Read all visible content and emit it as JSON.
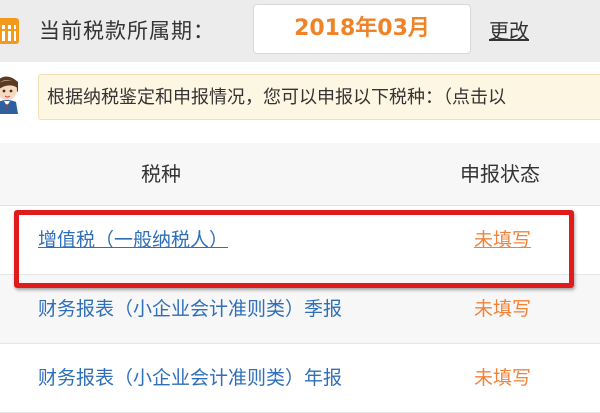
{
  "header": {
    "period_label": "当前税款所属期：",
    "period_value": "2018年03月",
    "change_link": "更改"
  },
  "notice": {
    "text": "根据纳税鉴定和申报情况，您可以申报以下税种：（点击以"
  },
  "table": {
    "columns": [
      "税种",
      "申报状态"
    ],
    "rows": [
      {
        "name": "增值税（一般纳税人）",
        "status": "未填写"
      },
      {
        "name": "财务报表（小企业会计准则类）季报",
        "status": "未填写"
      },
      {
        "name": "财务报表（小企业会计准则类）年报",
        "status": "未填写"
      }
    ]
  },
  "icons": {
    "calendar": "calendar-icon",
    "avatar": "assistant-avatar-icon"
  },
  "colors": {
    "accent_orange": "#ef8326",
    "link_blue": "#2f6fba",
    "status_orange": "#f2823a",
    "highlight_red": "#e01b1b",
    "notice_bg": "#fdf6e3"
  }
}
